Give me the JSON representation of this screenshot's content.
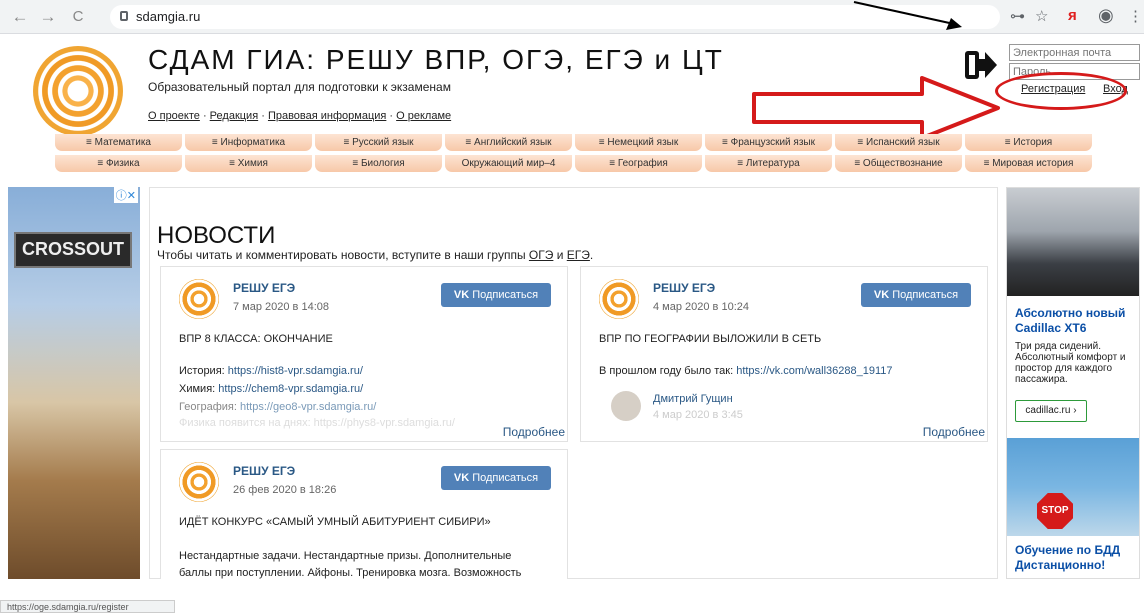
{
  "browser": {
    "url": "sdamgia.ru",
    "back": "←",
    "forward": "→",
    "reload": "C",
    "key": "⊶",
    "star": "☆",
    "ya": "я",
    "menu": "⋮"
  },
  "site": {
    "title": "СДАМ ГИА: РЕШУ ВПР, ОГЭ, ЕГЭ и ЦТ",
    "subtitle": "Образовательный портал для подготовки к экзаменам",
    "links": [
      "О проекте",
      "Редакция",
      "Правовая информация",
      "О рекламе"
    ]
  },
  "login": {
    "email_placeholder": "Электронная почта",
    "password_placeholder": "Пароль",
    "register": "Регистрация",
    "enter": "Вход"
  },
  "subjects": {
    "row1": [
      "≡ Математика",
      "≡ Информатика",
      "≡ Русский язык",
      "≡ Английский язык",
      "≡ Немецкий язык",
      "≡ Французский язык",
      "≡ Испанский язык",
      "≡ История"
    ],
    "row2": [
      "≡ Физика",
      "≡ Химия",
      "≡ Биология",
      "Окружающий мир–4",
      "≡ География",
      "≡ Литература",
      "≡ Обществознание",
      "≡ Мировая история"
    ]
  },
  "ad_left": {
    "logo": "CROSSOUT",
    "close": "ⓘ✕"
  },
  "news": {
    "title": "НОВОСТИ",
    "intro_before": "Чтобы читать и комментировать новости, вступите в наши группы ",
    "intro_oge": "ОГЭ",
    "intro_and": " и ",
    "intro_ege": "ЕГЭ",
    "intro_after": ".",
    "subscribe": "Подписаться",
    "more": "Подробнее",
    "cards": [
      {
        "name": "РЕШУ ЕГЭ",
        "date": "7 мар 2020 в 14:08",
        "headline": "ВПР 8 КЛАССА: ОКОНЧАНИЕ",
        "l1_label": "История: ",
        "l1_url": "https://hist8-vpr.sdamgia.ru/",
        "l2_label": "Химия: ",
        "l2_url": "https://chem8-vpr.sdamgia.ru/",
        "l3_label": "География: ",
        "l3_url": "https://geo8-vpr.sdamgia.ru/",
        "l4": "Физика появится на днях: https://phys8-vpr.sdamgia.ru/"
      },
      {
        "name": "РЕШУ ЕГЭ",
        "date": "4 мар 2020 в 10:24",
        "headline": "ВПР ПО ГЕОГРАФИИ ВЫЛОЖИЛИ В СЕТЬ",
        "l1_label": "В прошлом году было так: ",
        "l1_url": "https://vk.com/wall36288_19117",
        "author": "Дмитрий Гущин",
        "author_date": "4 мар 2020 в 3:45"
      },
      {
        "name": "РЕШУ ЕГЭ",
        "date": "26 фев 2020 в 18:26",
        "headline": "ИДЁТ КОНКУРС «САМЫЙ УМНЫЙ АБИТУРИЕНТ СИБИРИ»",
        "l1": "Нестандартные задачи. Нестандартные призы. Дополнительные",
        "l2": "баллы при поступлении. Айфоны. Тренировка мозга. Возможность"
      }
    ]
  },
  "ad_right": {
    "title": "Абсолютно новый Cadillac XT6",
    "text": "Три ряда сидений. Абсолютный комфорт и простор для каждого пассажира.",
    "button": "cadillac.ru ›",
    "title2": "Обучение по БДД Дистанционно!",
    "stop": "STOP"
  },
  "status": "https://oge.sdamgia.ru/register"
}
